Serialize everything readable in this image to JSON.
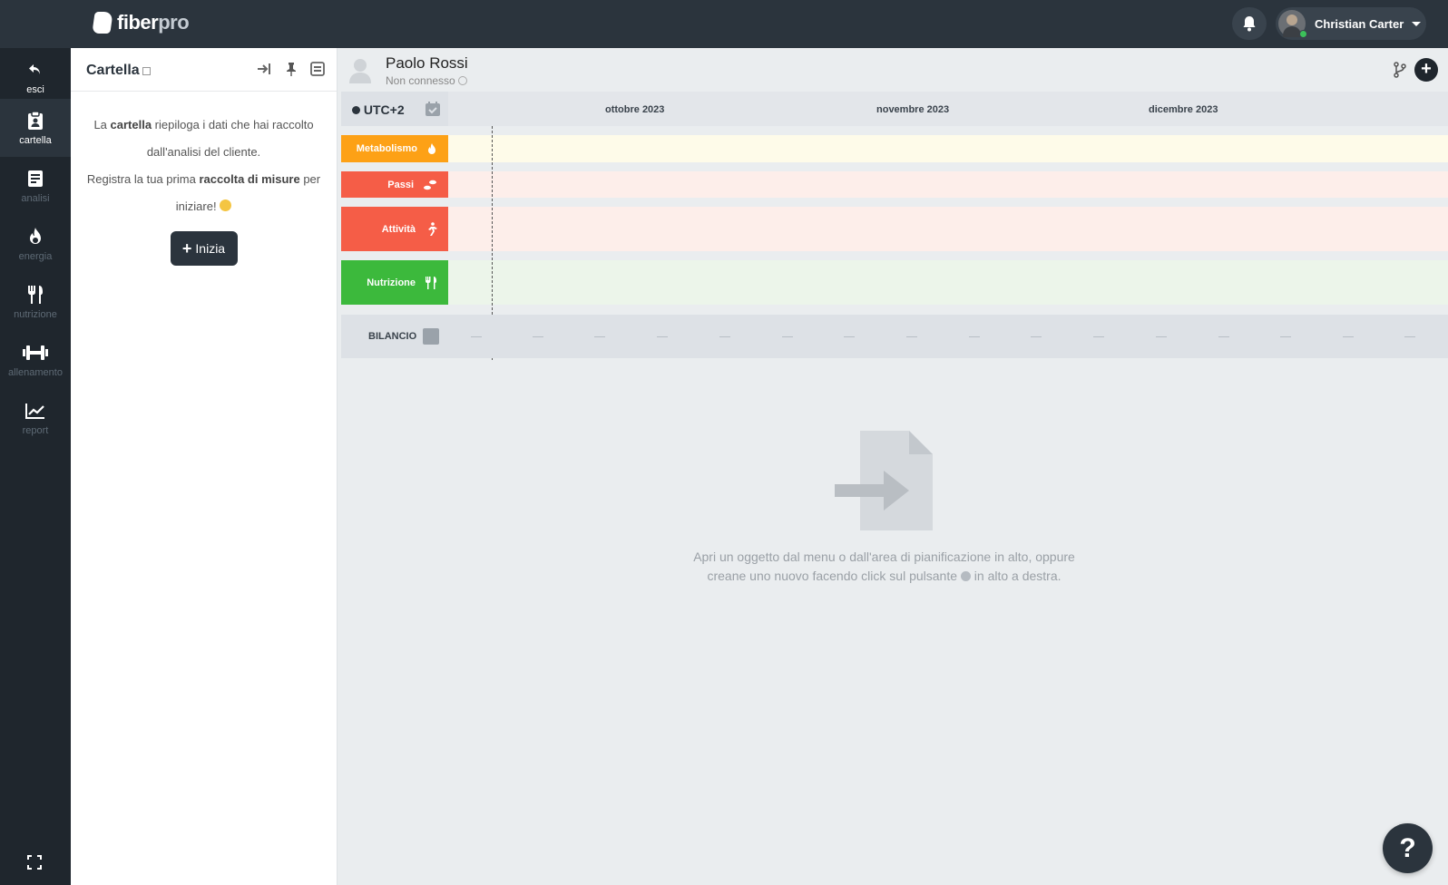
{
  "app": {
    "logo_prefix": "fiber",
    "logo_suffix": "pro",
    "user_name": "Christian Carter"
  },
  "nav": {
    "items": [
      {
        "label": "esci",
        "icon": "back-arrow-icon"
      },
      {
        "label": "cartella",
        "icon": "clipboard-icon"
      },
      {
        "label": "analisi",
        "icon": "document-icon"
      },
      {
        "label": "energia",
        "icon": "flame-icon"
      },
      {
        "label": "nutrizione",
        "icon": "fork-knife-icon"
      },
      {
        "label": "allenamento",
        "icon": "dumbbell-icon"
      },
      {
        "label": "report",
        "icon": "chart-line-icon"
      }
    ]
  },
  "panel": {
    "title": "Cartella",
    "text_1a": "La ",
    "text_1b": "cartella",
    "text_1c": " riepiloga i dati che hai raccolto dall'analisi del cliente.",
    "text_2a": "Registra la tua prima ",
    "text_2b": "raccolta di misure",
    "text_2c": " per iniziare! ",
    "button_label": "Inizia"
  },
  "client": {
    "name": "Paolo Rossi",
    "status": "Non connesso"
  },
  "timeline": {
    "timezone": "UTC+2",
    "months": [
      "ottobre 2023",
      "novembre 2023",
      "dicembre 2023"
    ],
    "categories": [
      {
        "label": "Metabolismo",
        "color": "#fda116",
        "lane": "#fefbe9",
        "icon": "flame-icon"
      },
      {
        "label": "Passi",
        "color": "#f55d47",
        "lane": "#fdeeea",
        "icon": "footsteps-icon"
      },
      {
        "label": "Attività",
        "color": "#f55d47",
        "lane": "#fdeeea",
        "icon": "running-icon"
      },
      {
        "label": "Nutrizione",
        "color": "#3cb93c",
        "lane": "#ecf5ea",
        "icon": "fork-knife-icon"
      }
    ],
    "balance_label": "BILANCIO"
  },
  "empty_state": {
    "line_1": "Apri un oggetto dal menu o dall'area di pianificazione in alto, oppure",
    "line_2a": "creane uno nuovo facendo click sul pulsante ",
    "line_2b": " in alto a destra."
  },
  "help_label": "?"
}
